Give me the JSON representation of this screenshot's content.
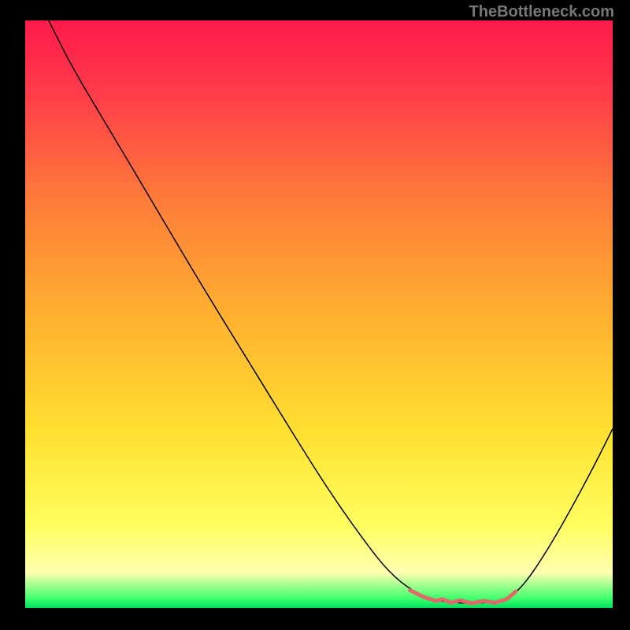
{
  "watermark": "TheBottleneck.com",
  "chart_data": {
    "type": "line",
    "title": "",
    "xlabel": "",
    "ylabel": "",
    "xlim": [
      0,
      100
    ],
    "ylim": [
      0,
      100
    ],
    "background_gradient": {
      "stops": [
        {
          "offset": 0.0,
          "color": "#ff1a4a"
        },
        {
          "offset": 0.12,
          "color": "#ff3a4a"
        },
        {
          "offset": 0.3,
          "color": "#ff7a3a"
        },
        {
          "offset": 0.5,
          "color": "#ffb030"
        },
        {
          "offset": 0.7,
          "color": "#ffe030"
        },
        {
          "offset": 0.86,
          "color": "#ffff60"
        },
        {
          "offset": 0.94,
          "color": "#ffffb0"
        },
        {
          "offset": 0.985,
          "color": "#3aff6a"
        },
        {
          "offset": 1.0,
          "color": "#00e060"
        }
      ]
    },
    "series": [
      {
        "name": "bottleneck-curve",
        "color": "#000000",
        "width": 1.5,
        "points": [
          {
            "x": 4.0,
            "y": 100.0
          },
          {
            "x": 8.0,
            "y": 92.0
          },
          {
            "x": 14.0,
            "y": 82.0
          },
          {
            "x": 22.0,
            "y": 68.5
          },
          {
            "x": 30.0,
            "y": 55.0
          },
          {
            "x": 38.0,
            "y": 42.0
          },
          {
            "x": 46.0,
            "y": 29.0
          },
          {
            "x": 52.0,
            "y": 19.5
          },
          {
            "x": 58.0,
            "y": 11.0
          },
          {
            "x": 62.0,
            "y": 6.0
          },
          {
            "x": 66.0,
            "y": 2.8
          },
          {
            "x": 70.0,
            "y": 1.2
          },
          {
            "x": 74.0,
            "y": 0.8
          },
          {
            "x": 78.0,
            "y": 0.8
          },
          {
            "x": 82.0,
            "y": 1.4
          },
          {
            "x": 85.0,
            "y": 4.0
          },
          {
            "x": 89.0,
            "y": 10.0
          },
          {
            "x": 93.0,
            "y": 17.0
          },
          {
            "x": 97.0,
            "y": 24.5
          },
          {
            "x": 100.0,
            "y": 30.5
          }
        ]
      }
    ],
    "highlight": {
      "name": "optimal-range",
      "color": "#e06a6a",
      "width": 5,
      "points": [
        {
          "x": 65.5,
          "y": 3.0
        },
        {
          "x": 68.0,
          "y": 1.8
        },
        {
          "x": 70.0,
          "y": 1.2
        },
        {
          "x": 71.0,
          "y": 1.5
        },
        {
          "x": 72.5,
          "y": 0.9
        },
        {
          "x": 74.0,
          "y": 1.3
        },
        {
          "x": 76.0,
          "y": 0.8
        },
        {
          "x": 78.0,
          "y": 1.2
        },
        {
          "x": 80.0,
          "y": 0.9
        },
        {
          "x": 82.0,
          "y": 1.5
        },
        {
          "x": 83.5,
          "y": 2.8
        }
      ]
    }
  }
}
